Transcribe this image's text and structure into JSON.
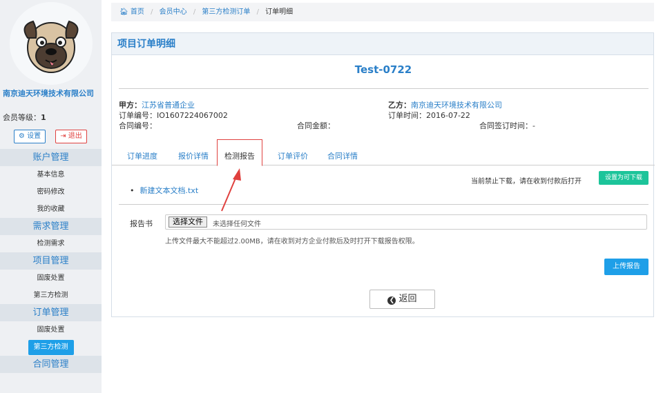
{
  "sidebar": {
    "company": "南京迪天环境技术有限公司",
    "level_label": "会员等级：",
    "level_value": "1",
    "settings_label": "设置",
    "logout_label": "退出",
    "menu": [
      {
        "group": "账户管理",
        "items": [
          "基本信息",
          "密码修改",
          "我的收藏"
        ]
      },
      {
        "group": "需求管理",
        "items": [
          "检测需求"
        ]
      },
      {
        "group": "项目管理",
        "items": [
          "固废处置",
          "第三方检测"
        ]
      },
      {
        "group": "订单管理",
        "items": [
          "固废处置",
          "第三方检测"
        ]
      },
      {
        "group": "合同管理",
        "items": []
      }
    ],
    "active_item": "第三方检测"
  },
  "breadcrumb": {
    "home": "首页",
    "member": "会员中心",
    "orders": "第三方检测订单",
    "current": "订单明细",
    "sep": "/"
  },
  "panel": {
    "title": "项目订单明细",
    "order_name": "Test-0722",
    "party_a_label": "甲方：",
    "party_a": "江苏省普通企业",
    "party_b_label": "乙方：",
    "party_b": "南京迪天环境技术有限公司",
    "order_no": "订单编号：IO1607224067002",
    "order_time": "订单时间：2016-07-22",
    "contract_no": "合同编号：",
    "contract_amount": "合同金额：",
    "contract_sign_time": "合同签订时间：-",
    "tabs": [
      "订单进度",
      "报价详情",
      "检测报告",
      "订单评价",
      "合同详情"
    ],
    "active_tab": 2,
    "download_note": "当前禁止下载，请在收到付款后打开",
    "allow_download": "设置为可下载",
    "file_name": "新建文本文档.txt",
    "report_label": "报告书",
    "choose_file": "选择文件",
    "no_file": "未选择任何文件",
    "hint": "上传文件最大不能超过2.00MB，请在收到对方企业付款后及时打开下载报告权限。",
    "upload": "上传报告",
    "back": "返回"
  },
  "colors": {
    "accent": "#2a7fc8",
    "danger": "#e0403e",
    "green": "#1cc49a",
    "active": "#1e9fe8"
  }
}
